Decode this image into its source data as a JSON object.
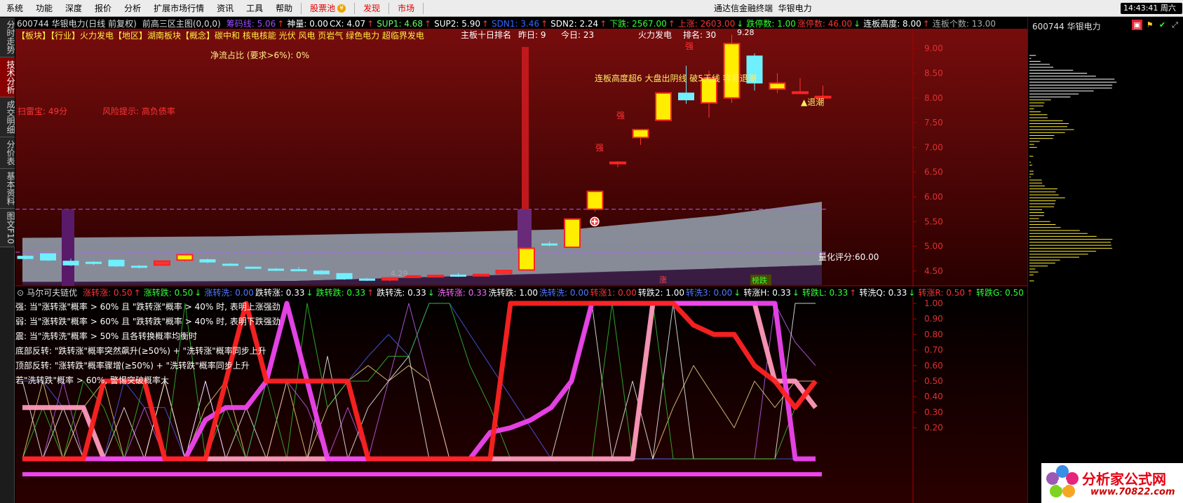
{
  "menu": {
    "items": [
      "系统",
      "功能",
      "深度",
      "报价",
      "分析",
      "扩展市场行情",
      "资讯",
      "工具",
      "帮助"
    ],
    "red_items": [
      "股票池",
      "发现",
      "市场"
    ],
    "title": "通达信金融终端",
    "stock_title": "华银电力",
    "clock": "14:43:41 周六"
  },
  "left_tabs": [
    {
      "label": "分时走势",
      "active": false
    },
    {
      "label": "技术分析",
      "active": true
    },
    {
      "label": "成交明细",
      "active": false
    },
    {
      "label": "分价表",
      "active": false
    },
    {
      "label": "基本资料",
      "active": false
    },
    {
      "label": "图文F10",
      "active": false
    }
  ],
  "main_header": {
    "code_name": "600744 华银电力(日线 前复权)",
    "formula": "前高三区主图(0,0,0)",
    "items": [
      {
        "text": "筹码线: 5.06",
        "color": "#9a4dff"
      },
      {
        "text": "↑",
        "color": "#ff3333"
      },
      {
        "text": "神量: 0.00",
        "color": "#ffffff"
      },
      {
        "text": "CX: 4.07",
        "color": "#ffffff"
      },
      {
        "text": "↑",
        "color": "#ff3333"
      },
      {
        "text": "SUP1: 4.68",
        "color": "#66ff66"
      },
      {
        "text": "↑",
        "color": "#ff3333"
      },
      {
        "text": "SUP2: 5.90",
        "color": "#ffffff"
      },
      {
        "text": "↑",
        "color": "#ff3333"
      },
      {
        "text": "SDN1: 3.46",
        "color": "#3366ff"
      },
      {
        "text": "↑",
        "color": "#ff3333"
      },
      {
        "text": "SDN2: 2.24",
        "color": "#ffffff"
      },
      {
        "text": "↑",
        "color": "#ff3333"
      },
      {
        "text": "下跌: 2567.00",
        "color": "#33ff33"
      },
      {
        "text": "↑",
        "color": "#ff3333"
      },
      {
        "text": "上涨: 2603.00",
        "color": "#ff3333"
      },
      {
        "text": "↓",
        "color": "#33ff33"
      },
      {
        "text": "跌停数: 1.00",
        "color": "#33ff33"
      },
      {
        "text": "涨停数: 46.00",
        "color": "#ff3333"
      },
      {
        "text": "↓",
        "color": "#33ff33"
      },
      {
        "text": "连板高度: 8.00",
        "color": "#ffffff"
      },
      {
        "text": "↑",
        "color": "#ff3333"
      },
      {
        "text": "连板个数: 13.00",
        "color": "#aaaaaa"
      }
    ]
  },
  "concepts_line": "【板块】【行业】火力发电【地区】湖南板块【概念】碳中和 核电核能 光伏 风电 页岩气 绿色电力 超临界发电",
  "annotations": {
    "rank_label": "主板十日排名",
    "yesterday": "昨日: 9",
    "today": "今日: 23",
    "sector": "火力发电",
    "rank": "排名: 30",
    "net_flow": "净流占比 (要求>6%): 0%",
    "mine": "扫雷宝: 49分",
    "risk": "风险提示: 高负债率",
    "peak_label": "9.28",
    "low_label": "4.29",
    "tui": "▲退潮",
    "score": "量化评分:60.00",
    "zhang": "涨",
    "qiang1": "强",
    "qiang2": "强",
    "qiang3": "强",
    "pattern_text": "连板高度超6  大盘出阴线  破5天线  容易退潮",
    "bangdie": "榜跌"
  },
  "price_axis": [
    "9.00",
    "8.50",
    "8.00",
    "7.50",
    "7.00",
    "6.50",
    "6.00",
    "5.50",
    "5.00",
    "4.50"
  ],
  "indicator_header": {
    "name": "马尔可夫链优",
    "items": [
      {
        "text": "涨转涨: 0.50",
        "color": "#ff3333"
      },
      {
        "text": "↑",
        "color": "#ff3333"
      },
      {
        "text": "涨转跌: 0.50",
        "color": "#33ff33"
      },
      {
        "text": "↓",
        "color": "#33ff33"
      },
      {
        "text": "涨转洗: 0.00",
        "color": "#5577ff"
      },
      {
        "text": "跌转涨: 0.33",
        "color": "#ffffff"
      },
      {
        "text": "↓",
        "color": "#33ff33"
      },
      {
        "text": "跌转跌: 0.33",
        "color": "#33ff33"
      },
      {
        "text": "↑",
        "color": "#ff3333"
      },
      {
        "text": "跌转洗: 0.33",
        "color": "#ffffff"
      },
      {
        "text": "↓",
        "color": "#33ff33"
      },
      {
        "text": "洗转涨: 0.33",
        "color": "#ff66ff"
      },
      {
        "text": "洗转跌: 1.00",
        "color": "#ffffff"
      },
      {
        "text": "洗转洗: 0.00",
        "color": "#5577ff"
      },
      {
        "text": "转涨1: 0.00",
        "color": "#ff3333"
      },
      {
        "text": "转跌2: 1.00",
        "color": "#ffffff"
      },
      {
        "text": "转洗3: 0.00",
        "color": "#5577ff"
      },
      {
        "text": "↓",
        "color": "#33ff33"
      },
      {
        "text": "转涨H: 0.33",
        "color": "#ffffff"
      },
      {
        "text": "↓",
        "color": "#33ff33"
      },
      {
        "text": "转跌L: 0.33",
        "color": "#33ff33"
      },
      {
        "text": "↑",
        "color": "#ff3333"
      },
      {
        "text": "转洗Q: 0.33",
        "color": "#ffffff"
      },
      {
        "text": "↓",
        "color": "#33ff33"
      },
      {
        "text": "转涨R: 0.50",
        "color": "#ff3333"
      },
      {
        "text": "↑",
        "color": "#ff3333"
      },
      {
        "text": "转跌G: 0.50",
        "color": "#33ff33"
      },
      {
        "text": "↑",
        "color": "#ff3333"
      }
    ],
    "notes": [
      "强: 当\"涨转涨\"概率 > 60% 且 \"跌转涨\"概率 > 40% 时, 表明上涨强劲",
      "弱: 当\"涨转跌\"概率 > 60% 且 \"跌转跌\"概率 > 40% 时, 表明下跌强劲",
      "震: 当\"洗转洗\"概率 > 50% 且各转换概率均衡时",
      "底部反转: \"跌转涨\"概率突然飙升(≥50%) + \"洗转涨\"概率同步上升",
      "顶部反转: \"涨转跌\"概率骤增(≥50%) + \"洗转跌\"概率同步上升",
      "若\"洗转跌\"概率 > 60%, 警惕突破概率大"
    ]
  },
  "indicator_axis": [
    "1.00",
    "0.90",
    "0.80",
    "0.70",
    "0.60",
    "0.50",
    "0.40",
    "0.30",
    "0.20"
  ],
  "right_panel": {
    "title": "600744 华银电力"
  },
  "logo": {
    "brand": "分析家公式网",
    "url": "www.70822.com"
  },
  "colors": {
    "up_body": "#ffee00",
    "up_edge": "#ff2222",
    "down_body": "#6ff0ff",
    "band": "#8c92a0",
    "bg_top": "#7a0d0d",
    "bg_bottom": "#000000"
  },
  "chart_data": {
    "type": "candlestick",
    "title": "600744 华银电力(日线 前复权)",
    "ylim": [
      4.2,
      9.4
    ],
    "candles": [
      {
        "o": 4.8,
        "h": 4.82,
        "l": 4.73,
        "c": 4.75
      },
      {
        "o": 4.85,
        "h": 4.86,
        "l": 4.7,
        "c": 4.72
      },
      {
        "o": 4.7,
        "h": 4.75,
        "l": 4.6,
        "c": 4.62
      },
      {
        "o": 4.68,
        "h": 4.7,
        "l": 4.62,
        "c": 4.65
      },
      {
        "o": 4.72,
        "h": 4.73,
        "l": 4.58,
        "c": 4.6
      },
      {
        "o": 4.6,
        "h": 4.62,
        "l": 4.55,
        "c": 4.58
      },
      {
        "o": 4.62,
        "h": 4.72,
        "l": 4.6,
        "c": 4.7
      },
      {
        "o": 4.72,
        "h": 4.84,
        "l": 4.68,
        "c": 4.83
      },
      {
        "o": 4.73,
        "h": 4.75,
        "l": 4.66,
        "c": 4.68
      },
      {
        "o": 4.64,
        "h": 4.66,
        "l": 4.6,
        "c": 4.62
      },
      {
        "o": 4.58,
        "h": 4.59,
        "l": 4.55,
        "c": 4.56
      },
      {
        "o": 4.54,
        "h": 4.56,
        "l": 4.5,
        "c": 4.53
      },
      {
        "o": 4.53,
        "h": 4.58,
        "l": 4.5,
        "c": 4.52
      },
      {
        "o": 4.5,
        "h": 4.52,
        "l": 4.42,
        "c": 4.44
      },
      {
        "o": 4.45,
        "h": 4.46,
        "l": 4.32,
        "c": 4.34
      },
      {
        "o": 4.34,
        "h": 4.36,
        "l": 4.3,
        "c": 4.31
      },
      {
        "o": 4.32,
        "h": 4.38,
        "l": 4.29,
        "c": 4.36
      },
      {
        "o": 4.38,
        "h": 4.42,
        "l": 4.36,
        "c": 4.4
      },
      {
        "o": 4.4,
        "h": 4.42,
        "l": 4.38,
        "c": 4.41
      },
      {
        "o": 4.42,
        "h": 4.46,
        "l": 4.38,
        "c": 4.4
      },
      {
        "o": 4.42,
        "h": 4.44,
        "l": 4.4,
        "c": 4.43
      },
      {
        "o": 4.45,
        "h": 4.52,
        "l": 4.44,
        "c": 4.51
      },
      {
        "o": 4.52,
        "h": 4.96,
        "l": 4.52,
        "c": 4.96
      },
      {
        "o": 5.05,
        "h": 5.1,
        "l": 5.0,
        "c": 5.04
      },
      {
        "o": 4.98,
        "h": 5.55,
        "l": 4.98,
        "c": 5.55
      },
      {
        "o": 5.75,
        "h": 6.11,
        "l": 5.7,
        "c": 6.11
      },
      {
        "o": 6.7,
        "h": 6.72,
        "l": 6.6,
        "c": 6.7
      },
      {
        "o": 7.2,
        "h": 7.36,
        "l": 7.05,
        "c": 7.36
      },
      {
        "o": 7.55,
        "h": 8.1,
        "l": 7.55,
        "c": 8.1
      },
      {
        "o": 8.1,
        "h": 8.65,
        "l": 7.88,
        "c": 7.96
      },
      {
        "o": 7.9,
        "h": 8.55,
        "l": 7.6,
        "c": 8.4
      },
      {
        "o": 8.0,
        "h": 9.28,
        "l": 7.9,
        "c": 9.1
      },
      {
        "o": 8.85,
        "h": 8.9,
        "l": 8.15,
        "c": 8.3
      },
      {
        "o": 8.18,
        "h": 8.5,
        "l": 8.1,
        "c": 8.3
      },
      {
        "o": 8.12,
        "h": 8.4,
        "l": 8.1,
        "c": 8.12
      },
      {
        "o": 8.02,
        "h": 8.25,
        "l": 7.92,
        "c": 8.03
      }
    ],
    "indicator": {
      "ylim": [
        0,
        1.05
      ],
      "series": [
        {
          "name": "涨转涨",
          "color": "#ff2222",
          "width": 7,
          "values": [
            0.0,
            0.0,
            0.0,
            0.0,
            0.5,
            0.5,
            0.5,
            0.0,
            0.0,
            0.0,
            0.5,
            1.0,
            0.5,
            0.5,
            0.5,
            0.5,
            0.5,
            0.0,
            0.0,
            0.0,
            0.0,
            0.0,
            0.0,
            0.0,
            1.0,
            1.0,
            1.0,
            1.0,
            1.0,
            1.0,
            1.0,
            1.0,
            1.0,
            0.86,
            0.8,
            0.8,
            0.6,
            0.5,
            0.33,
            0.5
          ]
        },
        {
          "name": "洗转涨",
          "color": "#ee44ee",
          "width": 7,
          "values": [
            0.0,
            0.0,
            0.0,
            0.0,
            0.0,
            0.0,
            0.0,
            0.0,
            0.0,
            0.25,
            0.33,
            0.33,
            0.5,
            1.0,
            0.5,
            0.0,
            0.0,
            0.0,
            0.0,
            0.0,
            0.0,
            0.0,
            0.0,
            0.17,
            0.2,
            0.25,
            0.33,
            0.5,
            1.0,
            1.0,
            1.0,
            1.0,
            1.0,
            1.0,
            1.0,
            1.0,
            1.0,
            1.0,
            0.0,
            0.0
          ]
        },
        {
          "name": "跌转洗",
          "color": "#ff99bb",
          "width": 7,
          "values": [
            0.33,
            0.33,
            0.33,
            0.33,
            0.0,
            0.0,
            0.0,
            0.0,
            0.0,
            0.0,
            0.0,
            0.0,
            0.0,
            0.0,
            0.0,
            0.0,
            0.0,
            0.0,
            0.0,
            0.0,
            0.0,
            0.0,
            0.0,
            0.0,
            0.0,
            0.0,
            0.0,
            0.0,
            0.0,
            0.0,
            0.0,
            1.0,
            1.0,
            1.0,
            1.0,
            1.0,
            1.0,
            0.5,
            0.5,
            0.33
          ]
        },
        {
          "name": "涨转跌",
          "color": "#33cc33",
          "width": 1,
          "values": [
            0.0,
            0.33,
            0.0,
            0.5,
            0.33,
            0.0,
            0.5,
            0.0,
            1.0,
            0.0,
            0.33,
            0.0,
            0.5,
            0.0,
            1.0,
            0.33,
            0.5,
            0.5,
            0.66,
            0.66,
            1.0,
            1.0,
            0.6,
            0.33,
            0.0,
            0.0,
            0.0,
            0.0,
            0.0,
            1.0,
            0.0,
            1.0,
            0.0,
            0.0,
            0.0,
            0.0,
            0.0,
            0.0,
            0.33,
            0.5
          ]
        },
        {
          "name": "跌转涨",
          "color": "#ffffff",
          "width": 1,
          "values": [
            0.5,
            0.0,
            0.33,
            0.0,
            0.0,
            0.33,
            0.0,
            0.5,
            0.0,
            0.5,
            0.0,
            0.33,
            0.0,
            0.0,
            0.0,
            0.66,
            0.0,
            0.33,
            0.5,
            0.66,
            0.0,
            0.0,
            0.0,
            0.0,
            0.0,
            0.0,
            0.0,
            0.5,
            1.0,
            0.0,
            0.5,
            0.0,
            1.0,
            0.0,
            0.0,
            0.0,
            0.0,
            0.0,
            1.0,
            1.0
          ]
        },
        {
          "name": "涨转洗",
          "color": "#4466ff",
          "width": 1,
          "values": [
            0.5,
            0.5,
            0.33,
            0.33,
            0.0,
            0.5,
            0.33,
            0.33,
            0.0,
            0.0,
            0.0,
            0.0,
            0.5,
            1.0,
            0.5,
            0.5,
            0.5,
            0.66,
            0.8,
            0.66,
            1.0,
            1.0,
            0.8,
            0.6,
            0.4,
            0.2,
            0.0,
            0.0,
            0.0,
            0.0,
            0.0,
            0.0,
            0.0,
            0.0,
            0.0,
            0.0,
            0.0,
            0.0,
            0.0,
            0.0
          ]
        },
        {
          "name": "跌转跌",
          "color": "#ffdd88",
          "width": 1,
          "values": [
            0.0,
            0.5,
            0.0,
            0.33,
            0.5,
            0.0,
            0.0,
            0.5,
            0.0,
            0.33,
            0.5,
            0.0,
            0.0,
            0.5,
            0.0,
            0.33,
            0.5,
            0.6,
            0.5,
            0.6,
            0.5,
            0.0,
            0.0,
            0.0,
            0.0,
            0.0,
            0.0,
            0.0,
            0.0,
            0.0,
            0.0,
            0.0,
            0.33,
            0.6,
            0.4,
            0.2,
            0.5,
            0.33,
            0.5,
            0.5
          ]
        },
        {
          "name": "转涨R",
          "color": "#cc66ff",
          "width": 1,
          "values": [
            0.0,
            0.0,
            0.5,
            0.0,
            0.0,
            0.0,
            0.33,
            0.0,
            0.0,
            0.5,
            0.0,
            0.0,
            0.0,
            0.5,
            0.33,
            0.0,
            0.33,
            0.0,
            0.5,
            1.0,
            0.5,
            0.0,
            0.0,
            0.0,
            0.0,
            0.0,
            0.0,
            0.0,
            0.0,
            0.0,
            0.0,
            0.0,
            0.0,
            0.0,
            0.0,
            0.0,
            0.0,
            1.0,
            0.75,
            0.6
          ]
        }
      ]
    }
  }
}
